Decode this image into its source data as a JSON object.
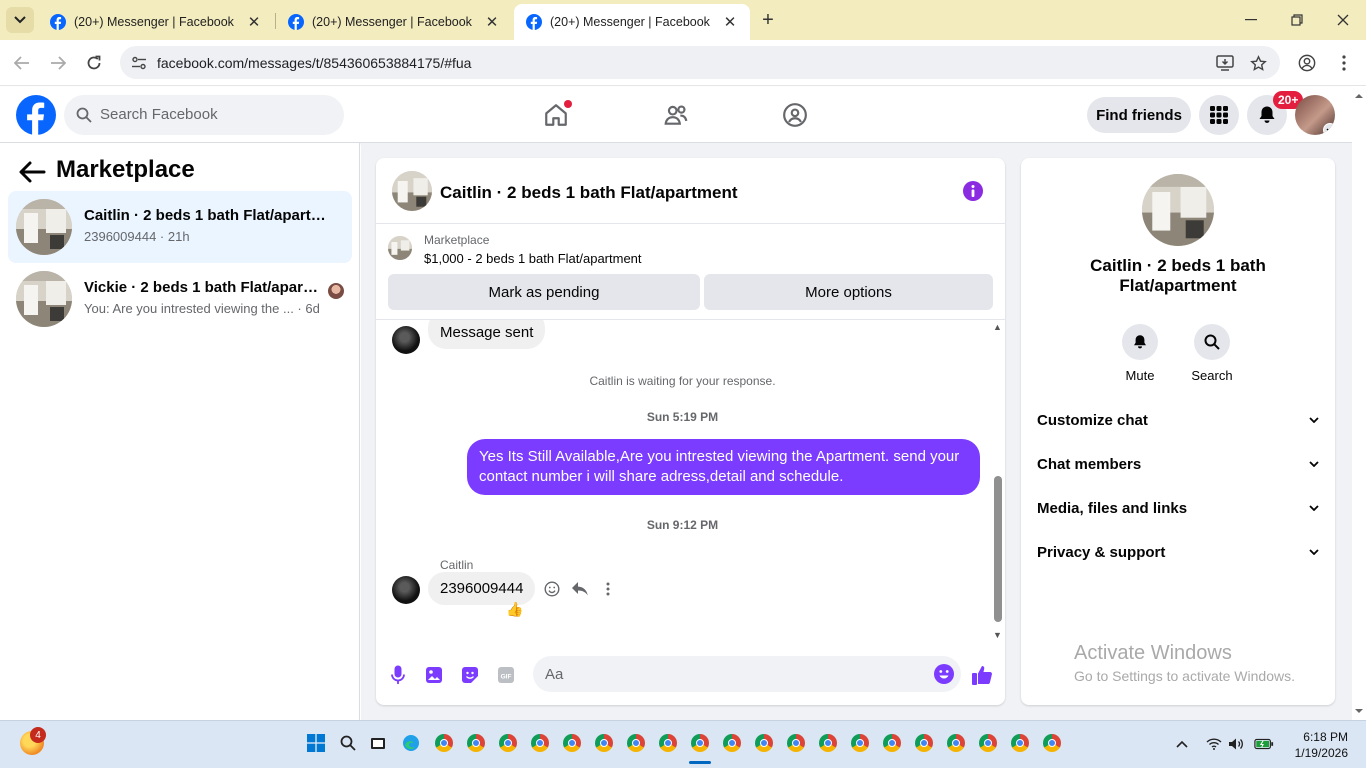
{
  "browser": {
    "tabs": [
      {
        "title": "(20+) Messenger | Facebook",
        "active": false
      },
      {
        "title": "(20+) Messenger | Facebook",
        "active": false
      },
      {
        "title": "(20+) Messenger | Facebook",
        "active": true
      }
    ],
    "new_tab_icon": "plus-icon",
    "url": "facebook.com/messages/t/854360653884175/#fua"
  },
  "fb_header": {
    "search_placeholder": "Search Facebook",
    "find_friends_label": "Find friends",
    "notifications_badge": "20+",
    "brand_color": "#0866ff"
  },
  "left_panel": {
    "title": "Marketplace",
    "conversations": [
      {
        "name": "Caitlin · 2 beds 1 bath Flat/apartment",
        "subtitle": "2396009444 · 21h",
        "selected": true
      },
      {
        "name": "Vickie · 2 beds 1 bath Flat/apartment",
        "subtitle": "You: Are you intrested viewing the ... · 6d",
        "selected": false
      }
    ]
  },
  "chat": {
    "title": "Caitlin · 2 beds 1 bath Flat/apartment",
    "listing_label": "Marketplace",
    "listing_price": "$1,000 - 2 beds 1 bath Flat/apartment",
    "mark_pending_label": "Mark as pending",
    "more_options_label": "More options",
    "messages": {
      "message_sent": "Message sent",
      "waiting_note": "Caitlin is waiting for your response.",
      "time_1": "Sun 5:19 PM",
      "outgoing": "Yes Its Still Available,Are you intrested viewing the Apartment. send your contact number i will share adress,detail and schedule.",
      "time_2": "Sun 9:12 PM",
      "sender": "Caitlin",
      "incoming": "2396009444",
      "reaction": "👍"
    },
    "composer_placeholder": "Aa",
    "accent_color": "#7b3cff"
  },
  "right_panel": {
    "name": "Caitlin · 2 beds 1 bath Flat/apartment",
    "mute_label": "Mute",
    "search_label": "Search",
    "sections": [
      "Customize chat",
      "Chat members",
      "Media, files and links",
      "Privacy & support"
    ],
    "watermark_title": "Activate Windows",
    "watermark_sub": "Go to Settings to activate Windows."
  },
  "taskbar": {
    "weather_badge": "4",
    "time": "6:18 PM",
    "date": "1/19/2026"
  }
}
